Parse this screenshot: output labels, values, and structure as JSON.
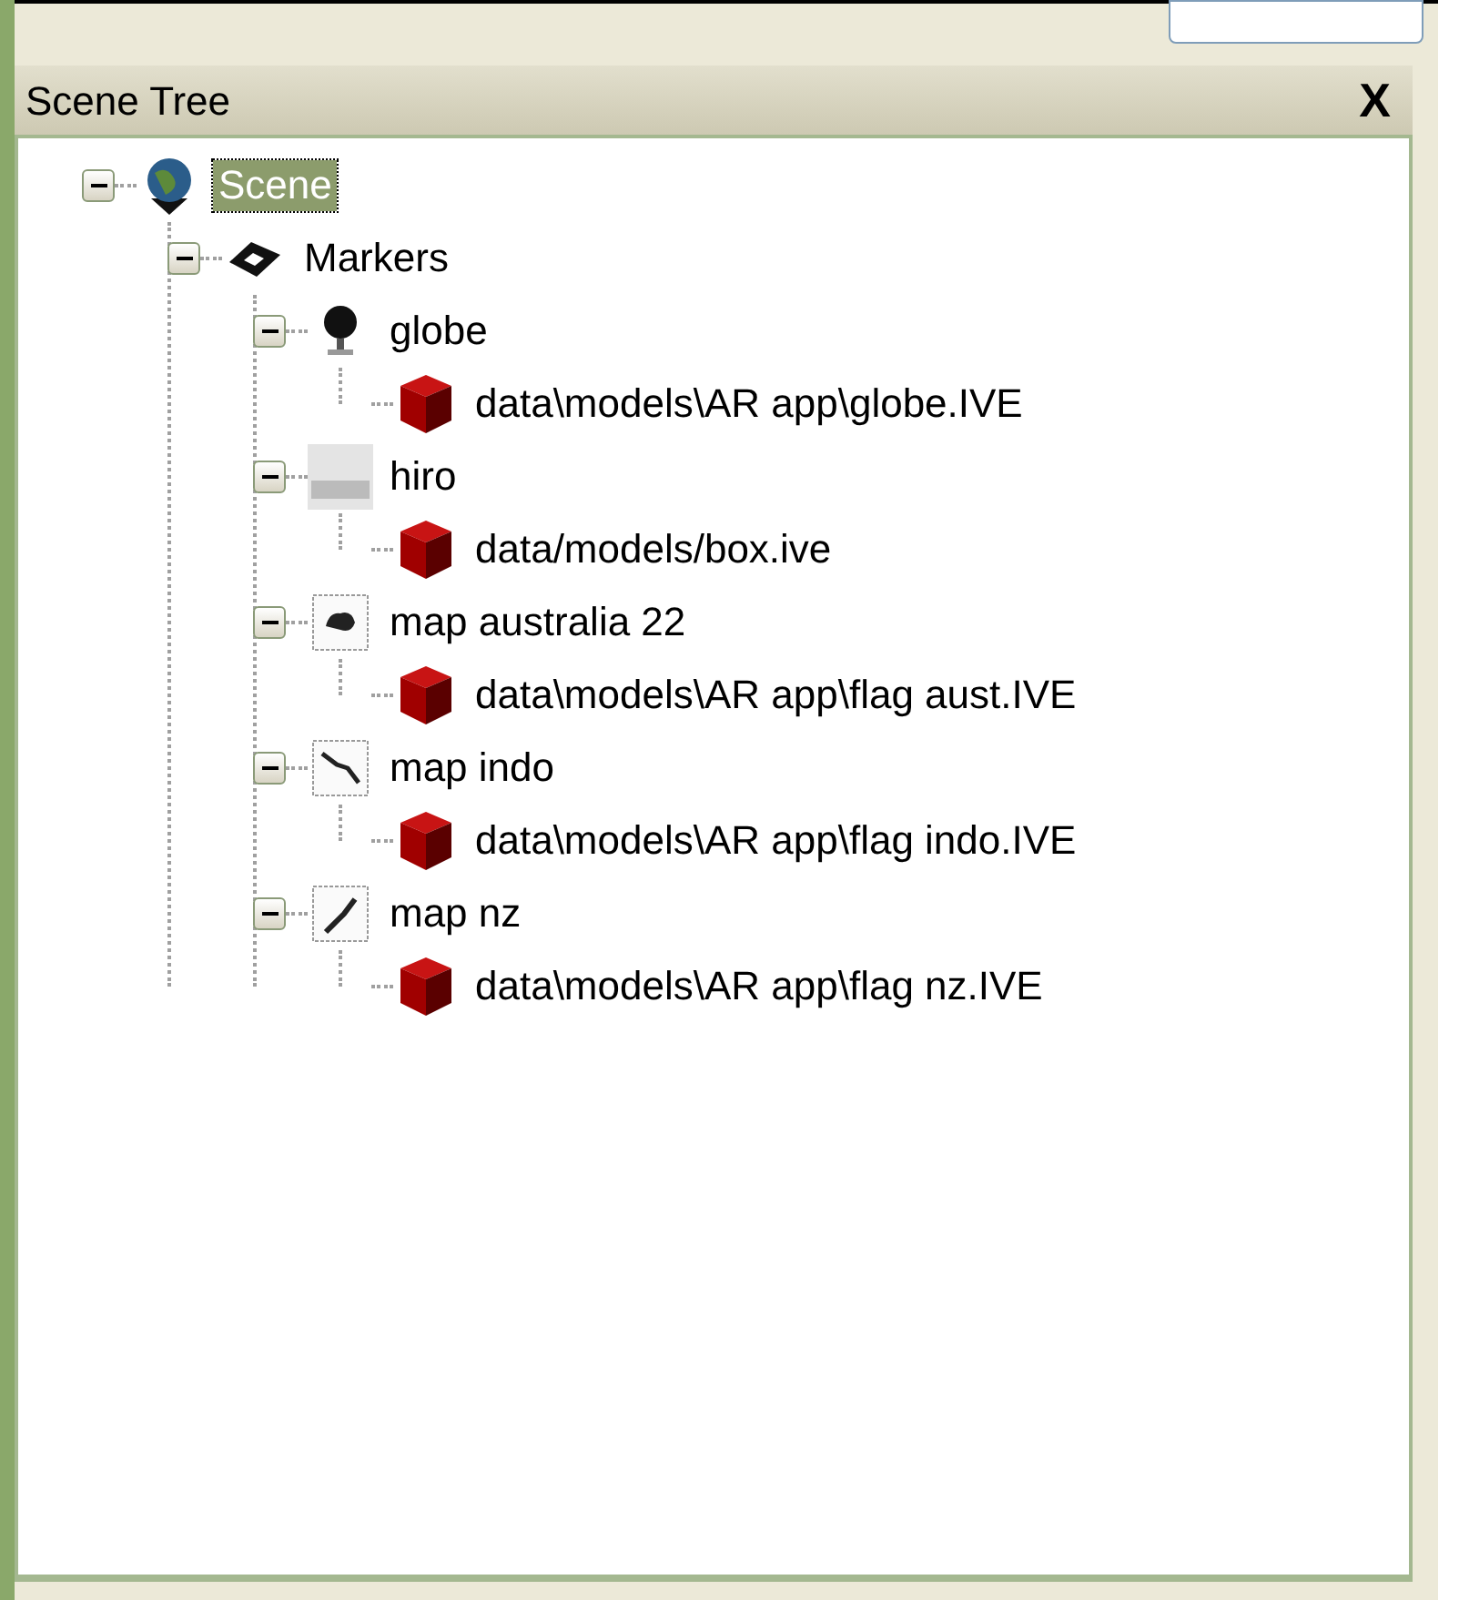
{
  "panel": {
    "title": "Scene Tree",
    "close": "X"
  },
  "tree": [
    {
      "label": "Scene",
      "kind": "scene",
      "selected": true,
      "expanded": true,
      "children": [
        {
          "label": "Markers",
          "kind": "markers",
          "selected": false,
          "expanded": true,
          "children": [
            {
              "label": "globe",
              "kind": "globe",
              "selected": false,
              "expanded": true,
              "children": [
                {
                  "label": "data\\models\\AR app\\globe.IVE",
                  "kind": "model",
                  "selected": false
                }
              ]
            },
            {
              "label": "hiro",
              "kind": "hiro",
              "selected": false,
              "expanded": true,
              "children": [
                {
                  "label": "data/models/box.ive",
                  "kind": "model",
                  "selected": false
                }
              ]
            },
            {
              "label": "map australia 22",
              "kind": "australia",
              "selected": false,
              "expanded": true,
              "children": [
                {
                  "label": "data\\models\\AR app\\flag aust.IVE",
                  "kind": "model",
                  "selected": false
                }
              ]
            },
            {
              "label": "map indo",
              "kind": "indo",
              "selected": false,
              "expanded": true,
              "children": [
                {
                  "label": "data\\models\\AR app\\flag indo.IVE",
                  "kind": "model",
                  "selected": false
                }
              ]
            },
            {
              "label": "map nz",
              "kind": "nz",
              "selected": false,
              "expanded": true,
              "children": [
                {
                  "label": "data\\models\\AR app\\flag nz.IVE",
                  "kind": "model",
                  "selected": false
                }
              ]
            }
          ]
        }
      ]
    }
  ]
}
